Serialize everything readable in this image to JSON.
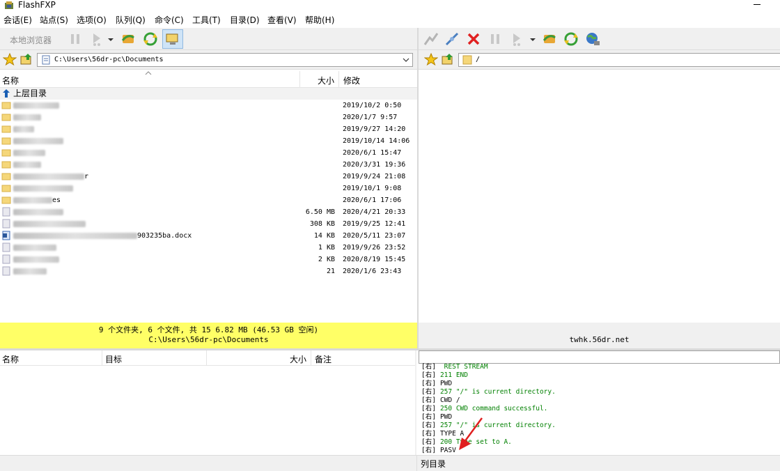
{
  "window": {
    "title": "FlashFXP"
  },
  "menu": [
    "会话(E)",
    "站点(S)",
    "选项(O)",
    "队列(Q)",
    "命令(C)",
    "工具(T)",
    "目录(D)",
    "查看(V)",
    "帮助(H)"
  ],
  "left_pane": {
    "toolbar_label": "本地浏览器",
    "path": "C:\\Users\\56dr-pc\\Documents",
    "columns": {
      "name": "名称",
      "size": "大小",
      "modified": "修改"
    },
    "parent_dir": "上层目录",
    "rows": [
      {
        "name_suffix": "",
        "size": "",
        "date": "2019/10/2 0:50",
        "type": "folder",
        "blur_w": 66
      },
      {
        "name_suffix": "",
        "size": "",
        "date": "2020/1/7 9:57",
        "type": "folder",
        "blur_w": 40
      },
      {
        "name_suffix": "",
        "size": "",
        "date": "2019/9/27 14:20",
        "type": "folder",
        "blur_w": 30
      },
      {
        "name_suffix": "",
        "size": "",
        "date": "2019/10/14 14:06",
        "type": "folder",
        "blur_w": 72
      },
      {
        "name_suffix": "",
        "size": "",
        "date": "2020/6/1 15:47",
        "type": "folder",
        "blur_w": 46
      },
      {
        "name_suffix": "",
        "size": "",
        "date": "2020/3/31 19:36",
        "type": "folder",
        "blur_w": 40
      },
      {
        "name_suffix": "r",
        "size": "",
        "date": "2019/9/24 21:08",
        "type": "folder",
        "blur_w": 102
      },
      {
        "name_suffix": "",
        "size": "",
        "date": "2019/10/1 9:08",
        "type": "folder",
        "blur_w": 86
      },
      {
        "name_suffix": "es",
        "size": "",
        "date": "2020/6/1 17:06",
        "type": "folder",
        "blur_w": 56
      },
      {
        "name_suffix": "",
        "size": "6.50 MB",
        "date": "2020/4/21 20:33",
        "type": "file",
        "blur_w": 72
      },
      {
        "name_suffix": "",
        "size": "308 KB",
        "date": "2019/9/25 12:41",
        "type": "file",
        "blur_w": 104
      },
      {
        "name_suffix": "903235ba.docx",
        "size": "14 KB",
        "date": "2020/5/11 23:07",
        "type": "doc",
        "blur_w": 178
      },
      {
        "name_suffix": "",
        "size": "1 KB",
        "date": "2019/9/26 23:52",
        "type": "file",
        "blur_w": 62
      },
      {
        "name_suffix": "",
        "size": "2 KB",
        "date": "2020/8/19 15:45",
        "type": "file",
        "blur_w": 66
      },
      {
        "name_suffix": "",
        "size": "21",
        "date": "2020/1/6 23:43",
        "type": "file",
        "blur_w": 48
      }
    ],
    "status_line1": "9 个文件夹, 6 个文件, 共 15 6.82 MB (46.53 GB 空闲)",
    "status_line2": "C:\\Users\\56dr-pc\\Documents"
  },
  "right_pane": {
    "path": "/",
    "status_host": "twhk.56dr.net"
  },
  "queue": {
    "columns": {
      "name": "名称",
      "target": "目标",
      "size": "大小",
      "note": "备注"
    }
  },
  "log": {
    "lines": [
      {
        "tag": "[右]",
        "text": " REST STREAM",
        "green": true
      },
      {
        "tag": "[右]",
        "text": "211 END",
        "green": true
      },
      {
        "tag": "[右]",
        "text": "PWD",
        "green": false
      },
      {
        "tag": "[右]",
        "text": "257 \"/\" is current directory.",
        "green": true
      },
      {
        "tag": "[右]",
        "text": "CWD /",
        "green": false
      },
      {
        "tag": "[右]",
        "text": "250 CWD command successful.",
        "green": true
      },
      {
        "tag": "[右]",
        "text": "PWD",
        "green": false
      },
      {
        "tag": "[右]",
        "text": "257 \"/\" is current directory.",
        "green": true
      },
      {
        "tag": "[右]",
        "text": "TYPE A",
        "green": false
      },
      {
        "tag": "[右]",
        "text": "200 Type set to A.",
        "green": true
      },
      {
        "tag": "[右]",
        "text": "PASV",
        "green": false
      }
    ]
  },
  "statusbar": {
    "text": "列目录"
  },
  "colors": {
    "status_yellow": "#ffff66",
    "log_green": "#008000",
    "arrow_red": "#e02020"
  }
}
